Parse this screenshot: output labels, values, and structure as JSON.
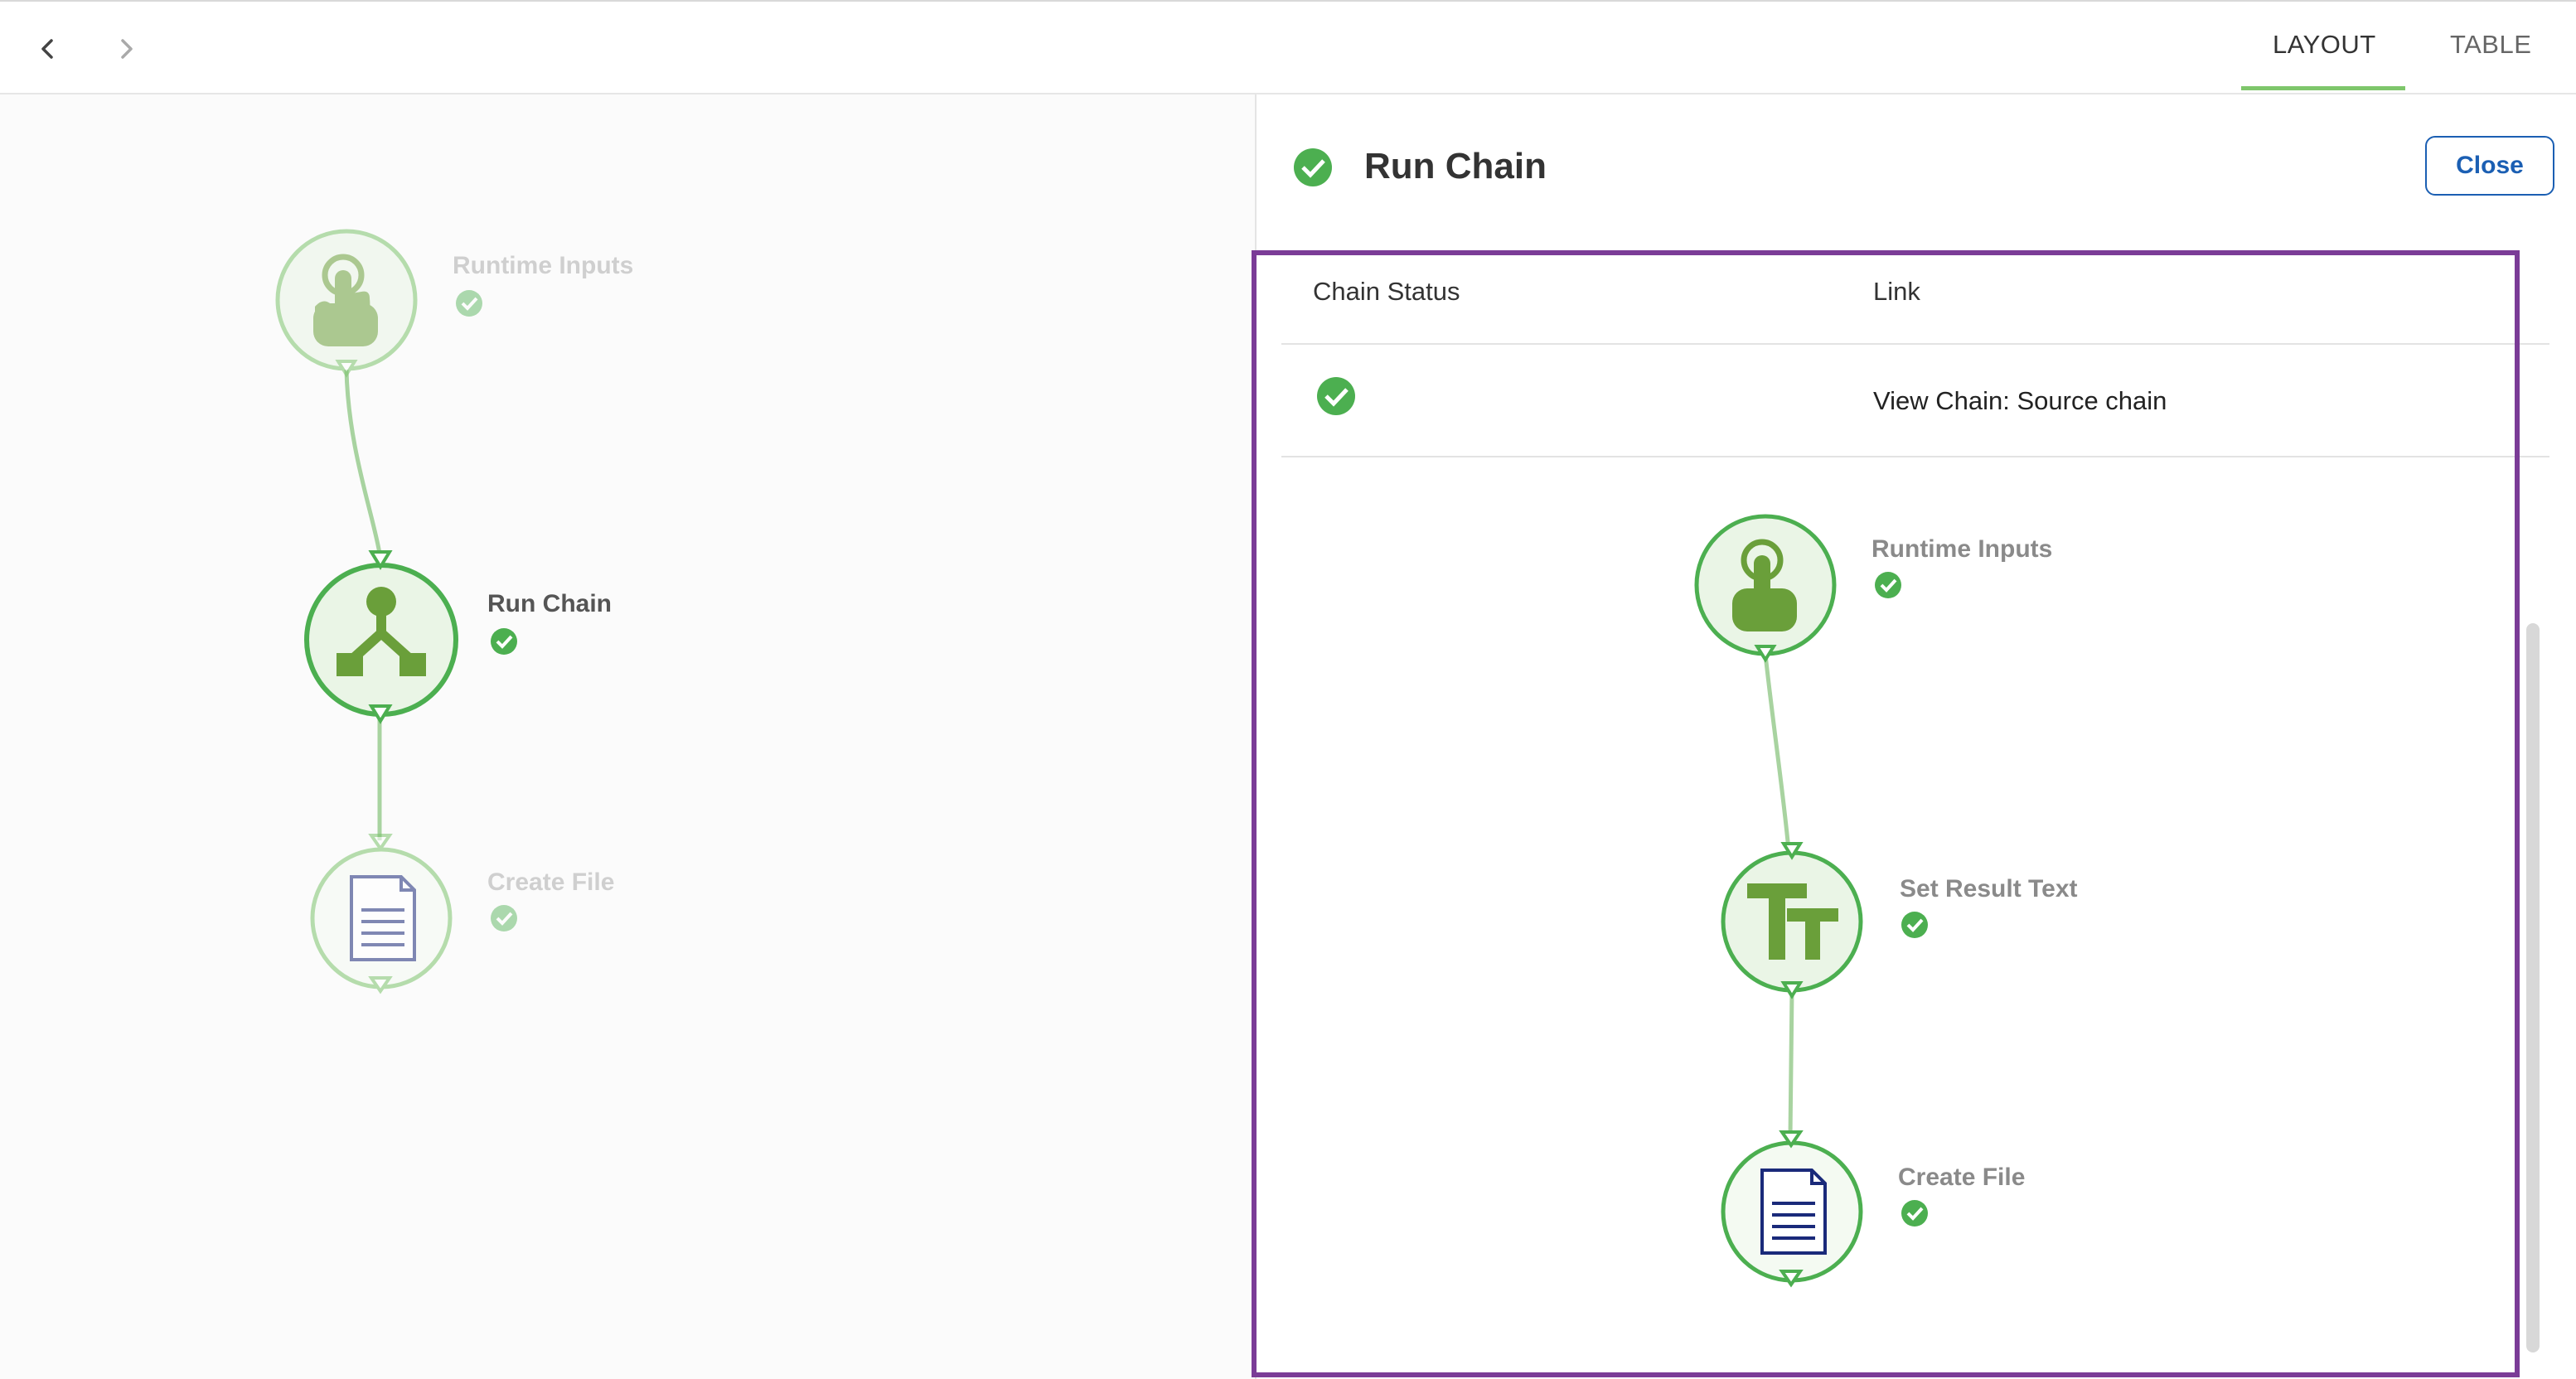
{
  "topbar": {
    "back_icon": "chevron-left-icon",
    "forward_icon": "chevron-right-icon",
    "tabs": [
      {
        "label": "LAYOUT",
        "active": true
      },
      {
        "label": "TABLE",
        "active": false
      }
    ]
  },
  "colors": {
    "accent_green": "#4caf50",
    "node_green": "#6a9f3a",
    "link_blue": "#1b5fb3",
    "highlight_purple": "#7b3c97",
    "doc_blue": "#1a2a7a"
  },
  "left_flow": {
    "nodes": [
      {
        "label": "Runtime Inputs",
        "icon": "pointer-hand-icon",
        "status": "success",
        "state": "faded"
      },
      {
        "label": "Run Chain",
        "icon": "run-chain-icon",
        "status": "success",
        "state": "selected"
      },
      {
        "label": "Create File",
        "icon": "document-icon",
        "status": "success",
        "state": "faded"
      }
    ]
  },
  "panel": {
    "title": "Run Chain",
    "title_status_icon": "check-circle-icon",
    "close_label": "Close",
    "table": {
      "headers": [
        "Chain Status",
        "Link"
      ],
      "rows": [
        {
          "status_icon": "check-circle-icon",
          "link": "View Chain: Source chain"
        }
      ]
    },
    "preview_flow": {
      "nodes": [
        {
          "label": "Runtime Inputs",
          "icon": "pointer-hand-icon",
          "status": "success"
        },
        {
          "label": "Set Result Text",
          "icon": "text-format-icon",
          "status": "success"
        },
        {
          "label": "Create File",
          "icon": "document-icon",
          "status": "success"
        }
      ]
    }
  }
}
